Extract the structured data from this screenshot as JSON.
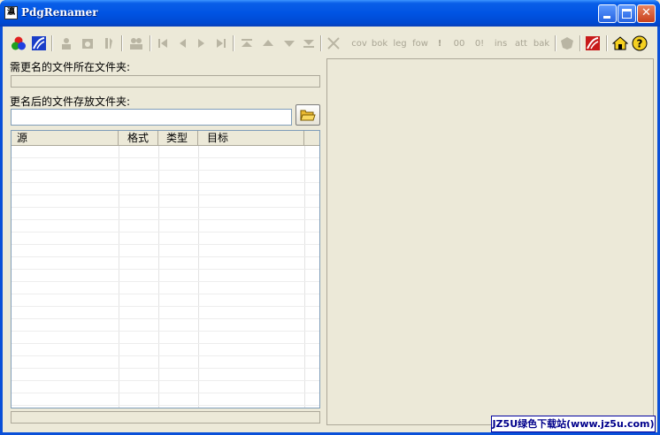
{
  "window": {
    "title": "PdgRenamer",
    "icon_text": "瀛",
    "controls": {
      "minimize": "minimize-icon",
      "maximize": "maximize-icon",
      "close": "✕"
    }
  },
  "toolbar": {
    "icons": [
      "color-circles-icon",
      "scan-icon",
      "user-icon",
      "camera-icon",
      "tools-icon",
      "users-icon",
      "first-icon",
      "prev-icon",
      "next-icon",
      "last-icon",
      "top-icon",
      "up-icon",
      "down-icon",
      "bottom-icon",
      "delete-icon",
      "shield-icon",
      "wave-icon",
      "home-icon",
      "help-icon"
    ],
    "text_buttons": [
      "cov",
      "bok",
      "leg",
      "fow",
      "!",
      "00",
      "0!",
      "ins",
      "att",
      "bak"
    ],
    "help_glyph": "?"
  },
  "source_folder": {
    "label": "需更名的文件所在文件夹:",
    "value": ""
  },
  "target_folder": {
    "label": "更名后的文件存放文件夹:",
    "value": ""
  },
  "file_table": {
    "columns": [
      "源",
      "格式",
      "类型",
      "目标"
    ],
    "rows": []
  },
  "status": {
    "text": ""
  },
  "watermark": "JZ5U绿色下载站(www.jz5u.com)",
  "colors": {
    "title_blue": "#0054e3",
    "face": "#ece9d8",
    "watermark_text": "#00008b"
  }
}
